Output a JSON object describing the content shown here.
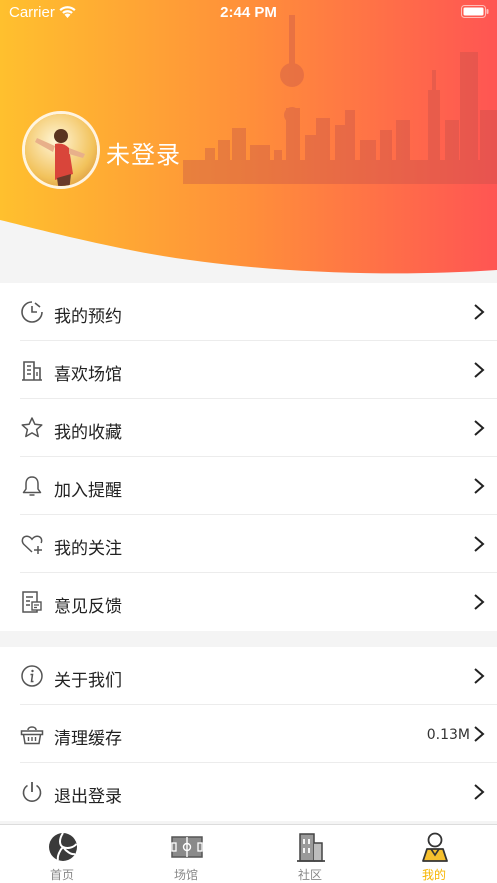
{
  "status_bar": {
    "carrier": "Carrier",
    "time": "2:44 PM"
  },
  "profile": {
    "username": "未登录"
  },
  "menu_main": [
    {
      "label": "我的预约",
      "icon": "clock-icon"
    },
    {
      "label": "喜欢场馆",
      "icon": "building-icon"
    },
    {
      "label": "我的收藏",
      "icon": "star-icon"
    },
    {
      "label": "加入提醒",
      "icon": "bell-icon"
    },
    {
      "label": "我的关注",
      "icon": "heart-plus-icon"
    },
    {
      "label": "意见反馈",
      "icon": "feedback-icon"
    }
  ],
  "menu_settings": [
    {
      "label": "关于我们",
      "icon": "info-icon",
      "value": ""
    },
    {
      "label": "清理缓存",
      "icon": "basket-icon",
      "value": "0.13M"
    },
    {
      "label": "退出登录",
      "icon": "power-icon",
      "value": ""
    }
  ],
  "tabbar": [
    {
      "label": "首页",
      "icon": "volleyball-icon",
      "active": false
    },
    {
      "label": "场馆",
      "icon": "field-icon",
      "active": false
    },
    {
      "label": "社区",
      "icon": "community-building-icon",
      "active": false
    },
    {
      "label": "我的",
      "icon": "user-icon",
      "active": true
    }
  ],
  "colors": {
    "gradient_start": "#ffc02e",
    "gradient_end": "#ff5553",
    "tab_active": "#f6b400",
    "tab_inactive": "#888888"
  }
}
